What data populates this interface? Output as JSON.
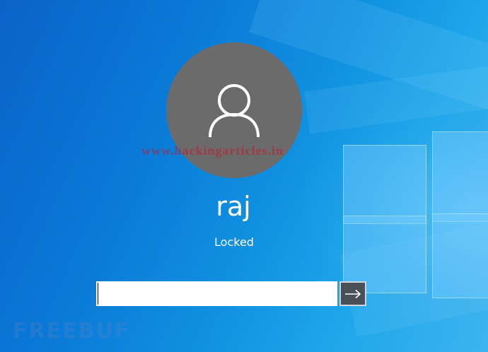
{
  "wallpaper": {
    "name": "Windows 10 default wallpaper",
    "colors": {
      "base": "#0a78d6",
      "light": "#3cb4ef",
      "logo_pane": "#78cdff"
    }
  },
  "user": {
    "avatar_icon": "user-icon",
    "avatar_color": "#6b6b6b",
    "name": "raj",
    "status": "Locked"
  },
  "password_field": {
    "value": "",
    "placeholder": ""
  },
  "submit": {
    "icon": "arrow-right-icon",
    "color": "#4a5058"
  },
  "watermarks": {
    "center": "www.hackingarticles.in",
    "corner": "FREEBUF"
  }
}
